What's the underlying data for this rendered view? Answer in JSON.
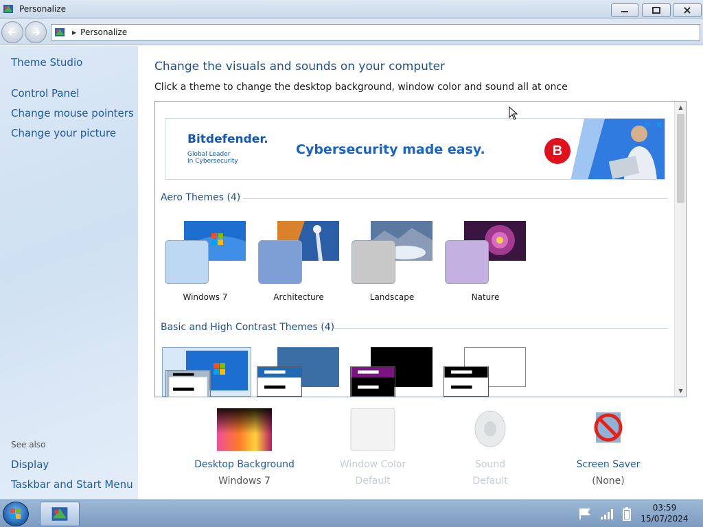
{
  "window": {
    "title": "Personalize",
    "buttons": {
      "minimize": "minimize",
      "maximize": "maximize",
      "close": "close"
    }
  },
  "address_bar": {
    "path": "Personalize"
  },
  "sidebar": {
    "top_links": [
      "Theme Studio",
      "Control Panel",
      "Change mouse pointers",
      "Change your picture"
    ],
    "see_also_label": "See also",
    "see_also_links": [
      "Display",
      "Taskbar and Start Menu"
    ]
  },
  "main": {
    "heading": "Change the visuals and sounds on your computer",
    "subheading": "Click a theme to change the desktop background, window color and sound all at once"
  },
  "ad": {
    "brand": "Bitdefender.",
    "tagline_line1": "Global Leader",
    "tagline_line2": "In Cybersecurity",
    "headline": "Cybersecurity made easy.",
    "logo_letter": "B",
    "adchoices": "▷",
    "close": "✕"
  },
  "groups": {
    "aero": {
      "label": "Aero Themes (4)",
      "themes": [
        {
          "name": "Windows 7",
          "glass": "#bcd8f3"
        },
        {
          "name": "Architecture",
          "glass": "#7d9fd5"
        },
        {
          "name": "Landscape",
          "glass": "#c8c8c8"
        },
        {
          "name": "Nature",
          "glass": "#c4b1e2"
        }
      ]
    },
    "basic": {
      "label": "Basic and High Contrast Themes (4)"
    }
  },
  "settings": [
    {
      "label": "Desktop Background",
      "value": "Windows 7",
      "enabled": true
    },
    {
      "label": "Window Color",
      "value": "Default",
      "enabled": false
    },
    {
      "label": "Sound",
      "value": "Default",
      "enabled": false
    },
    {
      "label": "Screen Saver",
      "value": "(None)",
      "enabled": true
    }
  ],
  "taskbar": {
    "time": "03:59",
    "date": "15/07/2024"
  },
  "colors": {
    "link": "#1e5ba8",
    "heading": "#1e4f8f",
    "sidebar_bg": "#d6e5f5",
    "ad_blue": "#1764c4",
    "ad_red": "#e0101c"
  }
}
